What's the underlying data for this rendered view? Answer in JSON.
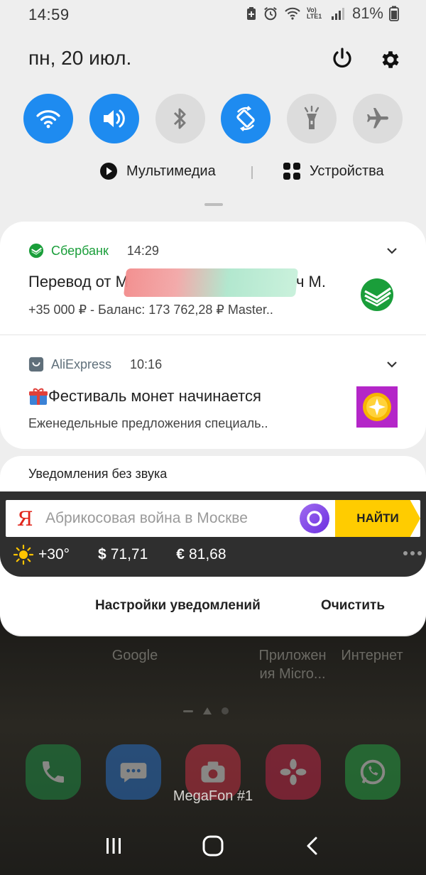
{
  "status_bar": {
    "time": "14:59",
    "battery_percent": "81%",
    "network_badge": "Vo) LTE1"
  },
  "header": {
    "date": "пн, 20 июл."
  },
  "quick_settings": {
    "tiles": [
      {
        "name": "wifi",
        "state": "on"
      },
      {
        "name": "sound",
        "state": "on"
      },
      {
        "name": "bluetooth",
        "state": "off"
      },
      {
        "name": "auto-rotate",
        "state": "on"
      },
      {
        "name": "flashlight",
        "state": "off"
      },
      {
        "name": "airplane",
        "state": "off"
      }
    ],
    "multimedia_label": "Мультимедиа",
    "devices_label": "Устройства"
  },
  "notifications": [
    {
      "app": "Сбербанк",
      "time": "14:29",
      "title_prefix": "Перевод от М",
      "title_suffix": "ч М.",
      "text": "+35 000 ₽ - Баланс: 173 762,28 ₽ Master.."
    },
    {
      "app": "AliExpress",
      "time": "10:16",
      "title": "Фестиваль монет начинается",
      "text": "Еженедельные предложения специаль.."
    }
  ],
  "silent": {
    "title": "Уведомления без звука",
    "yandex": {
      "logo": "Я",
      "placeholder": "Абрикосовая война в Москве",
      "find_label": "НАЙТИ",
      "weather": "+30°",
      "usd": "71,71",
      "eur": "81,68"
    }
  },
  "footer": {
    "settings_label": "Настройки уведомлений",
    "clear_label": "Очистить"
  },
  "home": {
    "labels": [
      "Google",
      "Приложен ия Micro...",
      "Интернет"
    ],
    "carrier": "MegaFon #1"
  },
  "colors": {
    "accent": "#1e8bf0",
    "sber_green": "#1a9e3a",
    "yandex_yellow": "#ffcc00"
  }
}
